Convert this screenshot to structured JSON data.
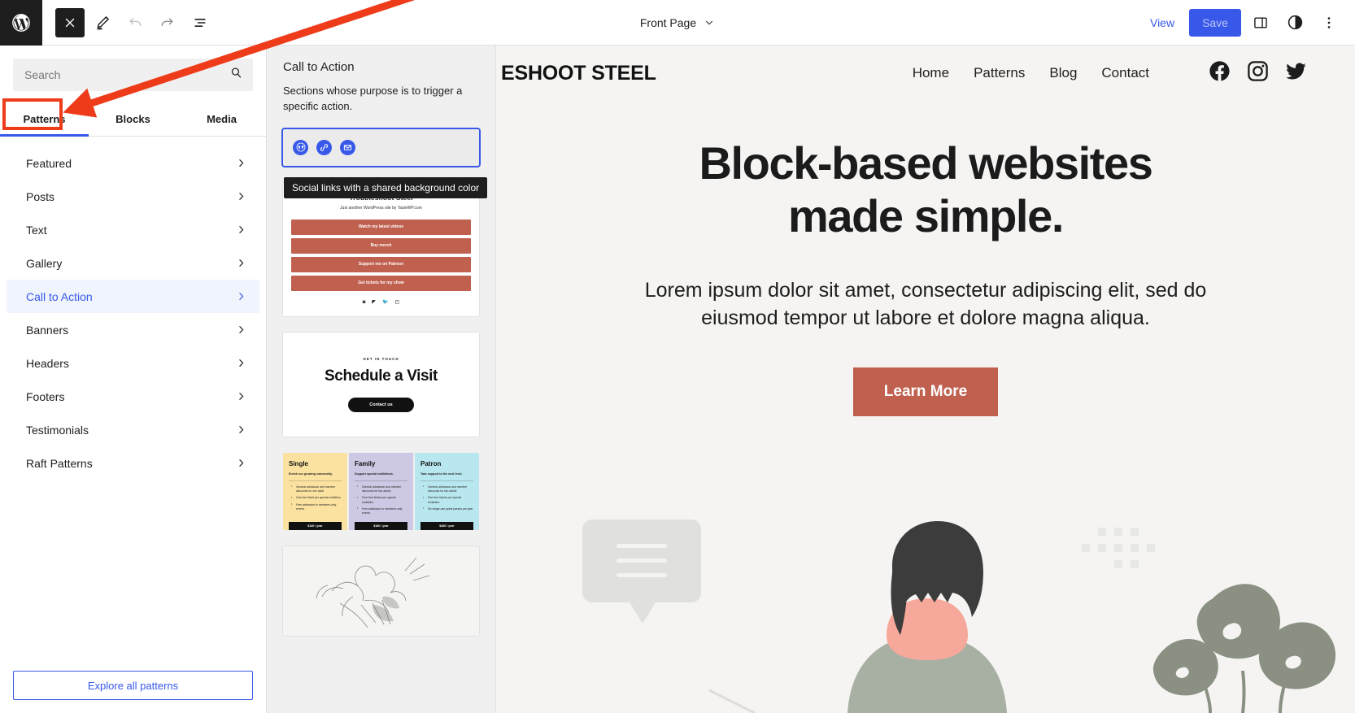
{
  "topbar": {
    "logo_icon": "wordpress-logo-icon",
    "close_label": "×",
    "tools": [
      {
        "name": "close-inserter-button",
        "icon": "close-icon"
      },
      {
        "name": "edit-tool-button",
        "icon": "pencil-icon"
      },
      {
        "name": "undo-button",
        "icon": "undo-icon"
      },
      {
        "name": "redo-button",
        "icon": "redo-icon"
      },
      {
        "name": "list-view-button",
        "icon": "list-view-icon"
      }
    ],
    "document_title": "Front Page",
    "view_label": "View",
    "save_label": "Save",
    "settings_icon": "sidebar-toggle-icon",
    "styles_icon": "contrast-icon",
    "options_icon": "more-vertical-icon"
  },
  "inserter": {
    "search": {
      "value": "",
      "placeholder": "Search"
    },
    "tabs": [
      {
        "label": "Patterns",
        "selected": true
      },
      {
        "label": "Blocks",
        "selected": false
      },
      {
        "label": "Media",
        "selected": false
      }
    ],
    "categories": [
      {
        "label": "Featured",
        "active": false
      },
      {
        "label": "Posts",
        "active": false
      },
      {
        "label": "Text",
        "active": false
      },
      {
        "label": "Gallery",
        "active": false
      },
      {
        "label": "Call to Action",
        "active": true
      },
      {
        "label": "Banners",
        "active": false
      },
      {
        "label": "Headers",
        "active": false
      },
      {
        "label": "Footers",
        "active": false
      },
      {
        "label": "Testimonials",
        "active": false
      },
      {
        "label": "Raft Patterns",
        "active": false
      }
    ],
    "explore_label": "Explore all patterns"
  },
  "pattern_panel": {
    "title": "Call to Action",
    "description": "Sections whose purpose is to trigger a specific action.",
    "tooltip": "Social links with a shared background color",
    "patterns": {
      "social_links": {
        "name": "Social links with a shared background color",
        "icons": [
          "wordpress-icon",
          "link-icon",
          "mail-icon"
        ],
        "selected": true
      },
      "link_in_bio": {
        "title": "Troubleshoot Steel",
        "subtitle": "Just another WordPress site by TasteWP.com",
        "buttons": [
          "Watch my latest videos",
          "Buy merch",
          "Support me on Patreon",
          "Get tickets for my show"
        ],
        "social_icons": [
          "instagram-icon",
          "facebook-icon",
          "twitter-icon",
          "tumblr-icon"
        ],
        "button_color": "#c0604f"
      },
      "schedule_visit": {
        "kicker": "GET IN TOUCH",
        "title": "Schedule a Visit",
        "button": "Contact us"
      },
      "pricing": {
        "columns": [
          {
            "name": "Single",
            "tagline": "Enrich our growing community.",
            "features": [
              "General admission and member discounts for one adult",
              "One free ticket per special exhibition",
              "Free admission to members-only events"
            ],
            "price": "$140 / year",
            "bg": "#fbe2a0"
          },
          {
            "name": "Family",
            "tagline": "Support special exhibitions.",
            "features": [
              "General admission and member discounts for two adults",
              "Four free tickets per special exhibition",
              "Free admission to members-only events"
            ],
            "price": "$180 / year",
            "bg": "#cdc8e3"
          },
          {
            "name": "Patron",
            "tagline": "Take support to the next level.",
            "features": [
              "General admission and member discounts for two adults",
              "Five free tickets per special exhibition",
              "Six single-use guest passes per year"
            ],
            "price": "$480 / year",
            "bg": "#b9e7ef"
          }
        ]
      },
      "botanical": {
        "name": "Botanical line drawing pattern"
      }
    }
  },
  "site": {
    "title": "ESHOOT STEEL",
    "nav": [
      "Home",
      "Patterns",
      "Blog",
      "Contact"
    ],
    "socials": [
      "facebook-icon",
      "instagram-icon",
      "twitter-icon"
    ],
    "hero": {
      "heading_line1": "Block-based websites",
      "heading_line2": "made simple.",
      "paragraph": "Lorem ipsum dolor sit amet, consectetur adipiscing elit, sed do eiusmod tempor ut labore et dolore magna aliqua.",
      "button": "Learn More"
    },
    "accent_color": "#c0604f",
    "background_color": "#f5f4f2"
  },
  "annotation": {
    "color": "#ee3b19",
    "target": "Patterns tab"
  }
}
